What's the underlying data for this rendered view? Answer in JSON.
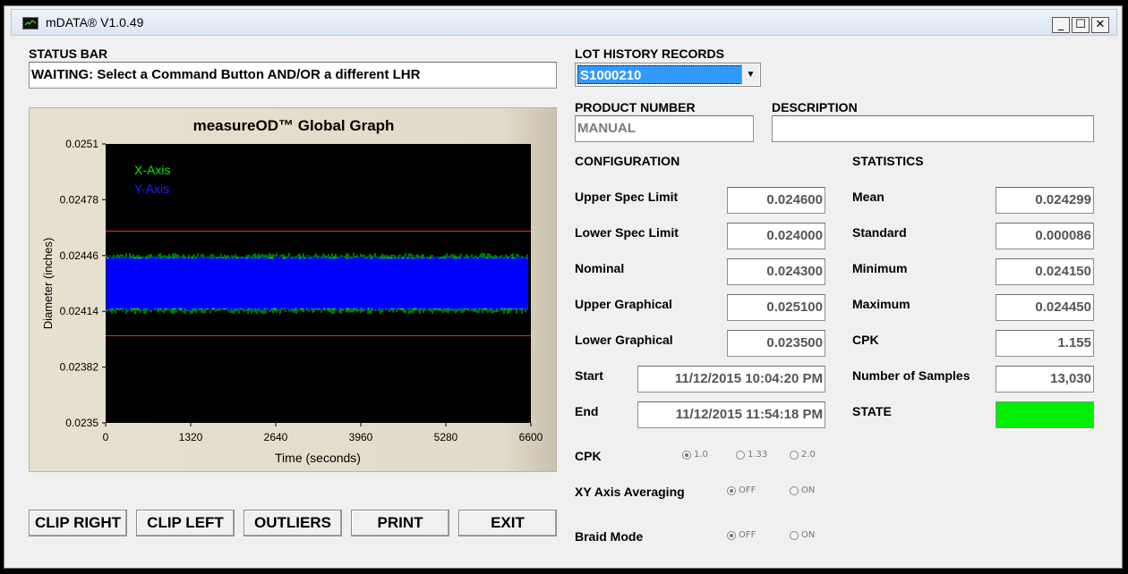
{
  "window": {
    "title": "mDATA® V1.0.49",
    "minimize": "_",
    "maximize": "☐",
    "close": "✕"
  },
  "status_bar": {
    "label": "STATUS BAR",
    "value": "WAITING: Select a Command Button AND/OR a different LHR"
  },
  "lot_history": {
    "label": "LOT HISTORY RECORDS",
    "selected": "S1000210"
  },
  "product_number": {
    "label": "PRODUCT NUMBER",
    "value": "MANUAL"
  },
  "description": {
    "label": "DESCRIPTION",
    "value": ""
  },
  "configuration": {
    "label": "CONFIGURATION",
    "upper_spec": {
      "label": "Upper Spec Limit",
      "value": "0.024600"
    },
    "lower_spec": {
      "label": "Lower Spec Limit",
      "value": "0.024000"
    },
    "nominal": {
      "label": "Nominal",
      "value": "0.024300"
    },
    "upper_graphical": {
      "label": "Upper Graphical",
      "value": "0.025100"
    },
    "lower_graphical": {
      "label": "Lower Graphical",
      "value": "0.023500"
    },
    "start": {
      "label": "Start",
      "value": "11/12/2015 10:04:20 PM"
    },
    "end": {
      "label": "End",
      "value": "11/12/2015 11:54:18 PM"
    }
  },
  "statistics": {
    "label": "STATISTICS",
    "mean": {
      "label": "Mean",
      "value": "0.024299"
    },
    "standard": {
      "label": "Standard",
      "value": "0.000086"
    },
    "minimum": {
      "label": "Minimum",
      "value": "0.024150"
    },
    "maximum": {
      "label": "Maximum",
      "value": "0.024450"
    },
    "cpk": {
      "label": "CPK",
      "value": "1.155"
    },
    "samples": {
      "label": "Number of Samples",
      "value": "13,030"
    },
    "state": {
      "label": "STATE",
      "color": "#00ee00"
    }
  },
  "options": {
    "cpk": {
      "label": "CPK",
      "choices": [
        "1.0",
        "1.33",
        "2.0"
      ],
      "selected": "1.0"
    },
    "xy_avg": {
      "label": "XY Axis Averaging",
      "choices": [
        "OFF",
        "ON"
      ],
      "selected": "OFF"
    },
    "braid": {
      "label": "Braid Mode",
      "choices": [
        "OFF",
        "ON"
      ],
      "selected": "OFF"
    }
  },
  "buttons": {
    "clip_right": "CLIP RIGHT",
    "clip_left": "CLIP LEFT",
    "outliers": "OUTLIERS",
    "print": "PRINT",
    "exit": "EXIT"
  },
  "chart_data": {
    "type": "line",
    "title": "measureOD™ Global Graph",
    "xlabel": "Time (seconds)",
    "ylabel": "Diameter (inches)",
    "xlim": [
      0,
      6600
    ],
    "ylim": [
      0.0235,
      0.0251
    ],
    "x_ticks": [
      "0",
      "1320",
      "2640",
      "3960",
      "5280",
      "6600"
    ],
    "y_ticks": [
      "0.0235",
      "0.02382",
      "0.02414",
      "0.02446",
      "0.02478",
      "0.0251"
    ],
    "spec_limits": {
      "upper": 0.0246,
      "lower": 0.024,
      "color": "#ff2020"
    },
    "grid": false,
    "legend_position": "top-left",
    "series": [
      {
        "name": "X-Axis",
        "color": "#00ee00",
        "y_min": 0.02415,
        "y_max": 0.02445
      },
      {
        "name": "Y-Axis",
        "color": "#0000ff",
        "y_min": 0.02416,
        "y_max": 0.02444
      }
    ]
  }
}
